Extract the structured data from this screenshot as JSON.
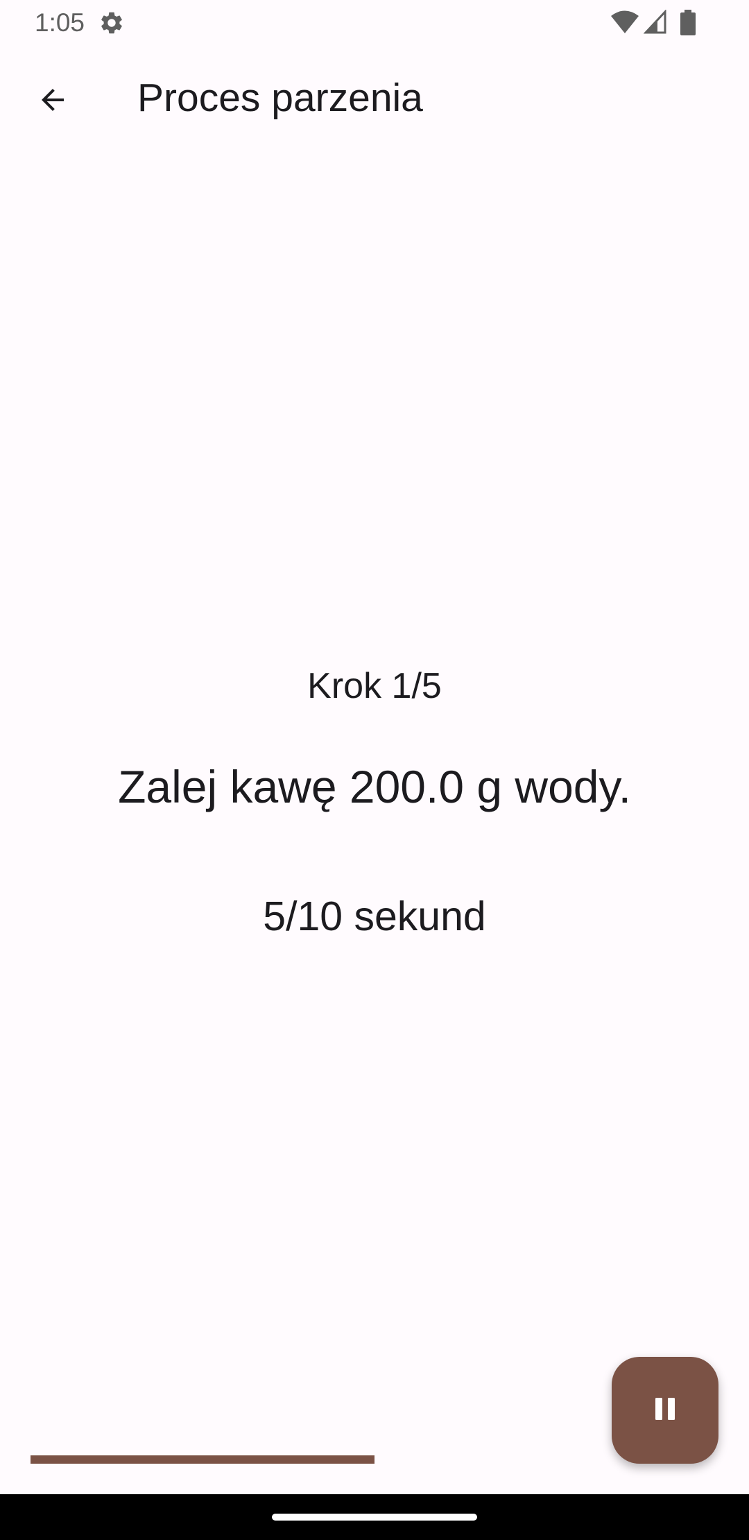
{
  "status_bar": {
    "time": "1:05",
    "icons": [
      "gear-icon",
      "wifi-icon",
      "signal-icon",
      "battery-icon"
    ]
  },
  "app_bar": {
    "title": "Proces parzenia",
    "back_icon": "arrow-back-icon"
  },
  "brew": {
    "step_label": "Krok 1/5",
    "instruction": "Zalej kawę 200.0 g wody.",
    "timer_text": "5/10 sekund",
    "progress_fraction": 0.5
  },
  "fab": {
    "icon": "pause-icon"
  },
  "colors": {
    "accent": "#7b5245",
    "background": "#fffbfe",
    "text": "#1c1b1f",
    "status_icons": "#5f5f5f",
    "nav_bar": "#000000"
  }
}
